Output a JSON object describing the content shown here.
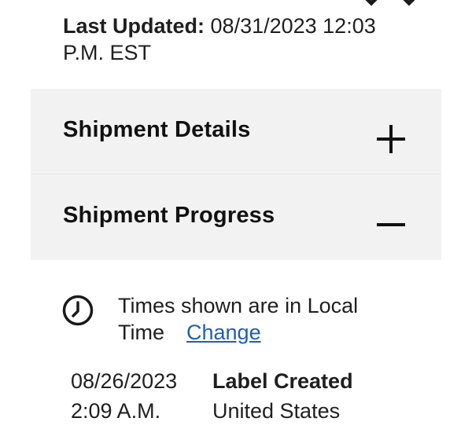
{
  "last_updated": {
    "label": "Last Updated:",
    "value": "08/31/2023 12:03 P.M. EST"
  },
  "accordions": [
    {
      "title": "Shipment Details",
      "icon": "plus-icon",
      "expanded": false
    },
    {
      "title": "Shipment Progress",
      "icon": "minus-icon",
      "expanded": true
    }
  ],
  "timezone_notice": {
    "icon": "clock-icon",
    "text": "Times shown are in Local Time",
    "link_label": "Change"
  },
  "events": [
    {
      "date": "08/26/2023",
      "time": "2:09 A.M.",
      "status": "Label Created",
      "location": "United States"
    }
  ],
  "colors": {
    "accordion_bg": "#f2f2f2",
    "link": "#1d5fb4",
    "text": "#1f1f1f"
  }
}
